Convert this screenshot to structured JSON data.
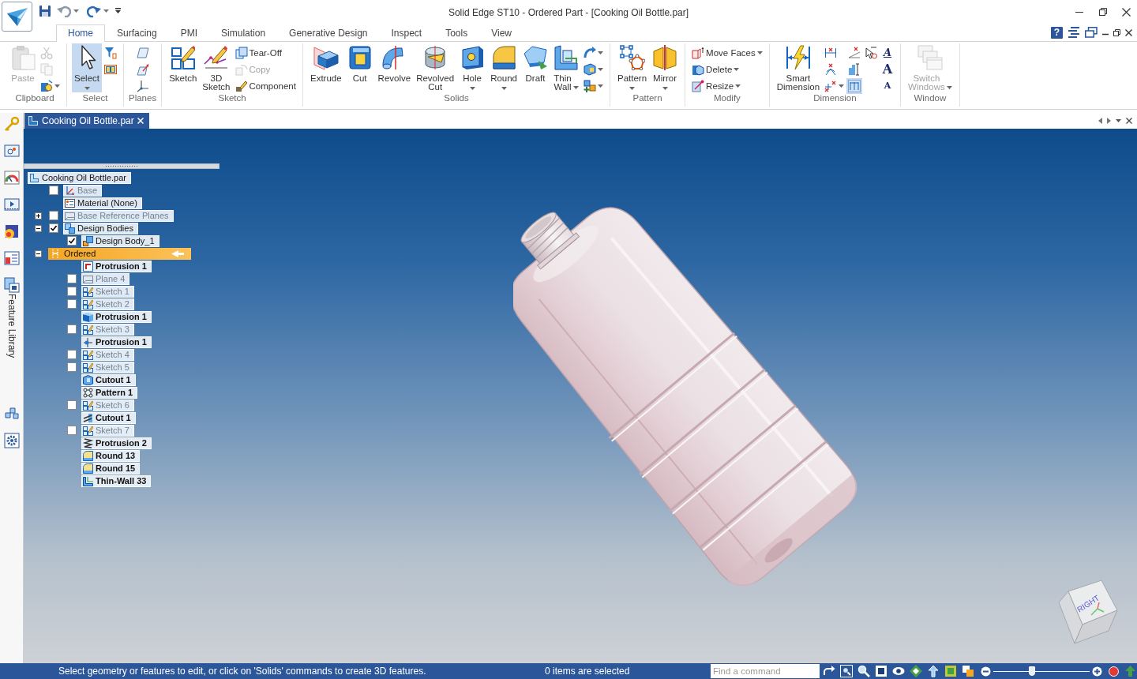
{
  "window": {
    "title": "Solid Edge ST10 - Ordered Part - [Cooking Oil Bottle.par]"
  },
  "ribbon_tabs": [
    {
      "label": "Home",
      "selected": true
    },
    {
      "label": "Surfacing",
      "selected": false
    },
    {
      "label": "PMI",
      "selected": false
    },
    {
      "label": "Simulation",
      "selected": false
    },
    {
      "label": "Generative Design",
      "selected": false
    },
    {
      "label": "Inspect",
      "selected": false
    },
    {
      "label": "Tools",
      "selected": false
    },
    {
      "label": "View",
      "selected": false
    }
  ],
  "help_button": {
    "label": "?"
  },
  "ribbon_groups": [
    {
      "label": "Clipboard",
      "items": [
        {
          "kind": "large",
          "label": "Paste",
          "disabled": true,
          "active": false,
          "dropdown": false
        },
        {
          "kind": "stack",
          "buttons": [
            {
              "disabled": true,
              "active": false,
              "dropdown": false
            },
            {
              "disabled": true,
              "active": false,
              "dropdown": false
            },
            {
              "disabled": false,
              "active": false,
              "dropdown": true
            }
          ]
        }
      ]
    },
    {
      "label": "Select",
      "items": [
        {
          "kind": "large",
          "label": "Select",
          "disabled": false,
          "active": true,
          "dropdown": true
        },
        {
          "kind": "stack",
          "buttons": [
            {
              "disabled": false,
              "active": false,
              "dropdown": false
            },
            {
              "disabled": false,
              "active": false,
              "dropdown": false
            }
          ]
        }
      ]
    },
    {
      "label": "Planes",
      "items": [
        {
          "kind": "stack",
          "buttons": [
            {
              "disabled": false,
              "active": false,
              "dropdown": false
            },
            {
              "disabled": false,
              "active": false,
              "dropdown": false
            },
            {
              "disabled": false,
              "active": false,
              "dropdown": false
            }
          ]
        }
      ]
    },
    {
      "label": "Sketch",
      "items": [
        {
          "kind": "large",
          "label": "Sketch",
          "disabled": false,
          "active": false,
          "dropdown": false
        },
        {
          "kind": "large",
          "label": "3D Sketch",
          "disabled": false,
          "active": false,
          "dropdown": false
        },
        {
          "kind": "stack",
          "buttons": [
            {
              "label": "Tear-Off",
              "disabled": false,
              "active": false,
              "dropdown": false
            },
            {
              "label": "Copy",
              "disabled": true,
              "active": false,
              "dropdown": false
            },
            {
              "label": "Component",
              "disabled": false,
              "active": false,
              "dropdown": false
            }
          ]
        }
      ]
    },
    {
      "label": "Solids",
      "items": [
        {
          "kind": "large",
          "label": "Extrude",
          "disabled": false,
          "active": false,
          "dropdown": false
        },
        {
          "kind": "large",
          "label": "Cut",
          "disabled": false,
          "active": false,
          "dropdown": false
        },
        {
          "kind": "large",
          "label": "Revolve",
          "disabled": false,
          "active": false,
          "dropdown": false
        },
        {
          "kind": "large",
          "label": "Revolved Cut",
          "disabled": false,
          "active": false,
          "dropdown": false
        },
        {
          "kind": "large",
          "label": "Hole",
          "disabled": false,
          "active": false,
          "dropdown": true
        },
        {
          "kind": "large",
          "label": "Round",
          "disabled": false,
          "active": false,
          "dropdown": true
        },
        {
          "kind": "large",
          "label": "Draft",
          "disabled": false,
          "active": false,
          "dropdown": false
        },
        {
          "kind": "large-inline",
          "label": "Thin Wall",
          "disabled": false,
          "active": false,
          "dropdown": true
        },
        {
          "kind": "stack",
          "buttons": [
            {
              "disabled": false,
              "active": false,
              "dropdown": true
            },
            {
              "disabled": false,
              "active": false,
              "dropdown": true
            },
            {
              "disabled": false,
              "active": false,
              "dropdown": true
            }
          ]
        }
      ]
    },
    {
      "label": "Pattern",
      "items": [
        {
          "kind": "large",
          "label": "Pattern",
          "disabled": false,
          "active": false,
          "dropdown": true
        },
        {
          "kind": "large",
          "label": "Mirror",
          "disabled": false,
          "active": false,
          "dropdown": true
        }
      ]
    },
    {
      "label": "Modify",
      "items": [
        {
          "kind": "stack",
          "buttons": [
            {
              "label": "Move Faces",
              "disabled": false,
              "active": false,
              "dropdown": true
            },
            {
              "label": "Delete",
              "disabled": false,
              "active": false,
              "dropdown": true
            },
            {
              "label": "Resize",
              "disabled": false,
              "active": false,
              "dropdown": true
            }
          ]
        }
      ]
    },
    {
      "label": "Dimension",
      "items": [
        {
          "kind": "large",
          "label": "Smart Dimension",
          "disabled": false,
          "active": false,
          "dropdown": false
        },
        {
          "kind": "stack",
          "buttons": [
            {
              "disabled": false,
              "active": false,
              "dropdown": false
            },
            {
              "disabled": false,
              "active": false,
              "dropdown": false
            },
            {
              "disabled": false,
              "active": false,
              "dropdown": true
            }
          ]
        },
        {
          "kind": "stack",
          "buttons": [
            {
              "disabled": false,
              "active": false,
              "dropdown": false
            },
            {
              "disabled": false,
              "active": false,
              "dropdown": false
            },
            {
              "disabled": false,
              "active": true,
              "dropdown": false
            }
          ]
        },
        {
          "kind": "stack",
          "buttons": [
            {
              "disabled": false,
              "active": false,
              "dropdown": false
            }
          ]
        },
        {
          "kind": "stack",
          "buttons": [
            {
              "glyph": "A",
              "disabled": false,
              "active": false,
              "dropdown": false
            },
            {
              "glyph": "A",
              "disabled": false,
              "active": false,
              "dropdown": false
            },
            {
              "glyph": "A",
              "disabled": false,
              "active": false,
              "dropdown": false
            }
          ]
        }
      ]
    },
    {
      "label": "Window",
      "items": [
        {
          "kind": "large-inline",
          "label": "Switch Windows",
          "disabled": true,
          "active": false,
          "dropdown": true
        }
      ]
    }
  ],
  "side_rail": {
    "tab_label": "Feature Library"
  },
  "document_tabs": [
    {
      "label": "Cooking Oil Bottle.par",
      "selected": true
    }
  ],
  "feature_tree": {
    "root": {
      "label": "Cooking Oil Bottle.par",
      "children": [
        {
          "kind": "item",
          "label": "Base",
          "checked": false
        },
        {
          "kind": "item",
          "label": "Material (None)"
        },
        {
          "kind": "item",
          "label": "Base Reference Planes",
          "checked": false,
          "expanded": false
        },
        {
          "kind": "item",
          "label": "Design Bodies",
          "checked": true,
          "expanded": true,
          "children": [
            {
              "kind": "item",
              "label": "Design Body_1",
              "checked": true
            }
          ]
        },
        {
          "kind": "group-bar",
          "label": "Ordered",
          "expanded": true,
          "children": [
            {
              "kind": "feature",
              "label": "Protrusion 1"
            },
            {
              "kind": "item",
              "label": "Plane 4",
              "checked": false
            },
            {
              "kind": "item",
              "label": "Sketch 1",
              "checked": false
            },
            {
              "kind": "item",
              "label": "Sketch 2",
              "checked": false
            },
            {
              "kind": "feature",
              "label": "Protrusion 1"
            },
            {
              "kind": "item",
              "label": "Sketch 3",
              "checked": false
            },
            {
              "kind": "feature",
              "label": "Protrusion 1"
            },
            {
              "kind": "item",
              "label": "Sketch 4",
              "checked": false
            },
            {
              "kind": "item",
              "label": "Sketch 5",
              "checked": false
            },
            {
              "kind": "feature",
              "label": "Cutout 1"
            },
            {
              "kind": "feature",
              "label": "Pattern 1"
            },
            {
              "kind": "item",
              "label": "Sketch 6",
              "checked": false
            },
            {
              "kind": "feature",
              "label": "Cutout 1"
            },
            {
              "kind": "item",
              "label": "Sketch 7",
              "checked": false
            },
            {
              "kind": "feature",
              "label": "Protrusion 2"
            },
            {
              "kind": "feature",
              "label": "Round 13"
            },
            {
              "kind": "feature",
              "label": "Round 15"
            },
            {
              "kind": "feature",
              "label": "Thin-Wall 33"
            }
          ]
        }
      ]
    }
  },
  "view_cube": {
    "face_label": "RIGHT"
  },
  "status_bar": {
    "prompt": "Select geometry or features to edit, or click on 'Solids' commands to create 3D features.",
    "selection": "0 items are selected",
    "command_search": {
      "placeholder": "Find a command"
    },
    "zoom": {
      "level": 0.4
    }
  }
}
